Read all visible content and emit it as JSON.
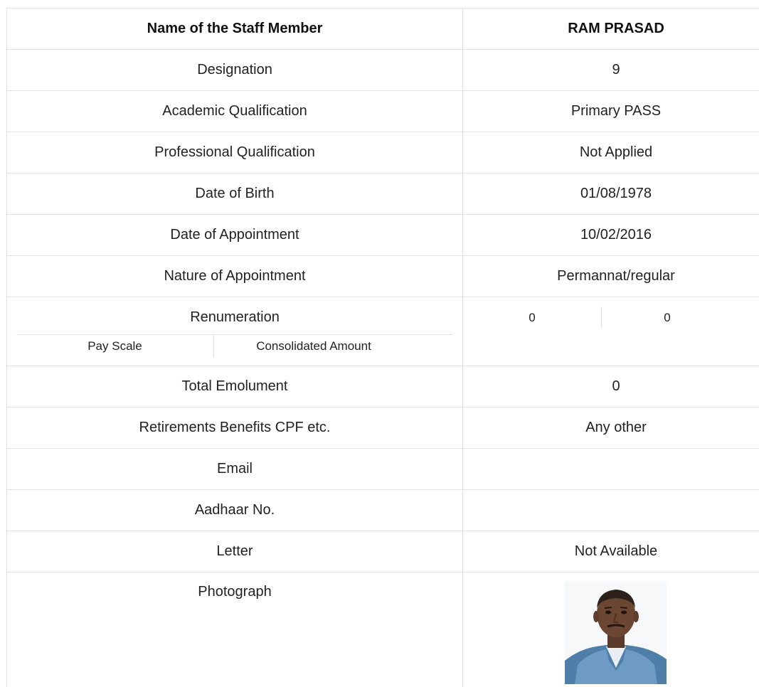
{
  "staff": {
    "header": {
      "label": "Name of the Staff Member",
      "value": "RAM PRASAD"
    },
    "rows": [
      {
        "label": "Designation",
        "value": "9"
      },
      {
        "label": "Academic Qualification",
        "value": "Primary PASS"
      },
      {
        "label": "Professional Qualification",
        "value": "Not Applied"
      },
      {
        "label": "Date of Birth",
        "value": "01/08/1978"
      },
      {
        "label": "Date of Appointment",
        "value": "10/02/2016"
      },
      {
        "label": "Nature of Appointment",
        "value": "Permannat/regular"
      }
    ],
    "renumeration": {
      "label": "Renumeration",
      "pay_scale_label": "Pay Scale",
      "consolidated_label": "Consolidated Amount",
      "pay_scale_value": "0",
      "consolidated_value": "0"
    },
    "rows_after": [
      {
        "label": "Total Emolument",
        "value": "0"
      },
      {
        "label": "Retirements Benefits CPF etc.",
        "value": "Any other"
      },
      {
        "label": "Email",
        "value": ""
      },
      {
        "label": "Aadhaar No.",
        "value": ""
      },
      {
        "label": "Letter",
        "value": "Not Available"
      }
    ],
    "photo": {
      "label": "Photograph"
    }
  }
}
